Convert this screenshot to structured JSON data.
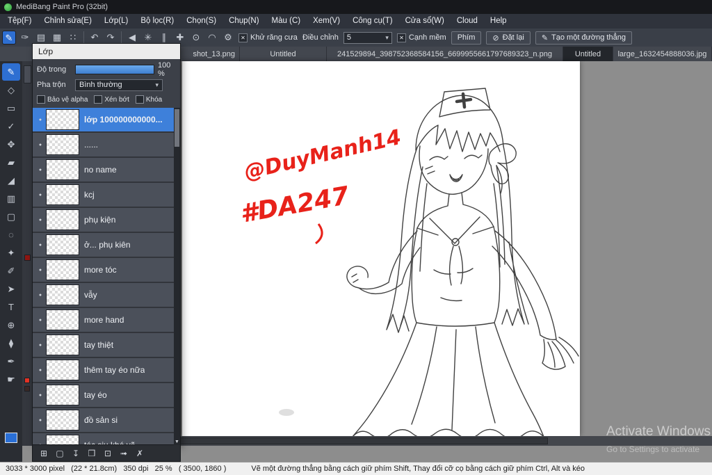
{
  "window": {
    "title": "MediBang Paint Pro (32bit)"
  },
  "menubar": {
    "items": [
      "Tệp(F)",
      "Chỉnh sửa(E)",
      "Lớp(L)",
      "Bộ lọc(R)",
      "Chọn(S)",
      "Chụp(N)",
      "Màu (C)",
      "Xem(V)",
      "Công cụ(T)",
      "Cửa sổ(W)",
      "Cloud",
      "Help"
    ]
  },
  "toolbar": {
    "icons": [
      {
        "name": "active-brush-chip",
        "glyph": "✎",
        "chip": true
      },
      {
        "name": "speech-bubble-icon",
        "glyph": "❝"
      },
      {
        "name": "pen-icon",
        "glyph": "✑"
      },
      {
        "name": "pages-icon",
        "glyph": "▤"
      },
      {
        "name": "grid-icon",
        "glyph": "▦"
      },
      {
        "name": "dots-icon",
        "glyph": "∷"
      },
      {
        "name": "sep1",
        "sep": true
      },
      {
        "name": "undo-icon",
        "glyph": "↶"
      },
      {
        "name": "redo-icon",
        "glyph": "↷"
      },
      {
        "name": "sep2",
        "sep": true
      },
      {
        "name": "prev-icon",
        "glyph": "◀"
      },
      {
        "name": "snap-off-icon",
        "glyph": "✳"
      },
      {
        "name": "snap-parallel-icon",
        "glyph": "∥"
      },
      {
        "name": "snap-cross-icon",
        "glyph": "✚"
      },
      {
        "name": "snap-vanish-icon",
        "glyph": "⊙"
      },
      {
        "name": "snap-ellipse-icon",
        "glyph": "◠"
      },
      {
        "name": "gear-icon",
        "glyph": "⚙"
      }
    ],
    "antialias_label": "Khử răng cưa",
    "adjust_label": "Điều chỉnh",
    "adjust_value": "5",
    "soft_edge_label": "Cạnh mềm",
    "key_button": "Phím",
    "reset_button": "Đặt lại",
    "reset_icon": "⊘",
    "line_button": "Tạo một đường thẳng",
    "line_icon": "✎",
    "check_mark": "✕"
  },
  "tabbar": {
    "tabs": [
      {
        "label": "shot_13.png",
        "active": false
      },
      {
        "label": "Untitled",
        "active": false
      },
      {
        "label": "241529894_398752368584156_6699955661797689323_n.png",
        "active": false
      },
      {
        "label": "Untitled",
        "active": true
      },
      {
        "label": "large_1632454888036.jpg",
        "active": false
      }
    ]
  },
  "tools": {
    "fg_color": "#2a6fd6",
    "items": [
      {
        "name": "brush-tool",
        "glyph": "✎",
        "active": true
      },
      {
        "name": "eraser-tool",
        "glyph": "◇"
      },
      {
        "name": "select-rect-tool",
        "glyph": "▭"
      },
      {
        "name": "dodge-tool",
        "glyph": "✓"
      },
      {
        "name": "move-tool",
        "glyph": "✥"
      },
      {
        "name": "shape-fill-tool",
        "glyph": "▰"
      },
      {
        "name": "bucket-tool",
        "glyph": "◢"
      },
      {
        "name": "gradient-tool",
        "glyph": "▥"
      },
      {
        "name": "marquee-tool",
        "glyph": "▢"
      },
      {
        "name": "lasso-tool",
        "glyph": "◌"
      },
      {
        "name": "magic-wand-tool",
        "glyph": "✦"
      },
      {
        "name": "select-pen-tool",
        "glyph": "✐"
      },
      {
        "name": "operation-tool",
        "glyph": "➤"
      },
      {
        "name": "text-tool",
        "glyph": "T"
      },
      {
        "name": "zoom-tool",
        "glyph": "⊕"
      },
      {
        "name": "eyedropper-tool",
        "glyph": "⧫"
      },
      {
        "name": "pen-tool",
        "glyph": "✒"
      },
      {
        "name": "hand-tool",
        "glyph": "☛"
      }
    ]
  },
  "layers_panel": {
    "title": "Lớp",
    "opacity_label": "Độ trong",
    "opacity_value": "100 %",
    "blend_label": "Pha trộn",
    "blend_value": "Bình thường",
    "protect_alpha_label": "Bảo vệ alpha",
    "clipping_label": "Xén bớt",
    "lock_label": "Khóa",
    "layers": [
      {
        "name": "lớp 100000000000...",
        "selected": true
      },
      {
        "name": "......",
        "selected": false
      },
      {
        "name": "no name",
        "selected": false
      },
      {
        "name": "kcj",
        "selected": false
      },
      {
        "name": "phụ kiện",
        "selected": false
      },
      {
        "name": "ở... phụ kiên",
        "selected": false
      },
      {
        "name": "more tóc",
        "selected": false
      },
      {
        "name": "vẫy",
        "selected": false
      },
      {
        "name": "more hand",
        "selected": false
      },
      {
        "name": "tay thiệt",
        "selected": false
      },
      {
        "name": "thêm tay éo nữa",
        "selected": false
      },
      {
        "name": "tay éo",
        "selected": false
      },
      {
        "name": "đồ sản si",
        "selected": false
      },
      {
        "name": "tóc siu khó vẽ",
        "selected": false
      }
    ],
    "action_icons": [
      {
        "name": "new-layer-icon",
        "glyph": "⊞"
      },
      {
        "name": "layer-icon",
        "glyph": "▢"
      },
      {
        "name": "merge-down-icon",
        "glyph": "↧"
      },
      {
        "name": "folder-icon",
        "glyph": "❒"
      },
      {
        "name": "duplicate-layer-icon",
        "glyph": "⊡"
      },
      {
        "name": "transfer-layer-icon",
        "glyph": "➟"
      },
      {
        "name": "delete-layer-icon",
        "glyph": "✗"
      }
    ]
  },
  "canvas": {
    "signature_line1": "@DuyManh14",
    "signature_line2": "#DA247"
  },
  "statusbar": {
    "doc_info": "3033 * 3000 pixel   (22 * 21.8cm)   350 dpi   25 %   ( 3500, 1860 )",
    "hint": "Vẽ một đường thẳng bằng cách giữ phím Shift, Thay đổi cỡ cọ bằng cách giữ phím Ctrl, Alt và kéo"
  },
  "watermark": {
    "line1": "Activate Windows",
    "line2": "Go to Settings to activate"
  }
}
